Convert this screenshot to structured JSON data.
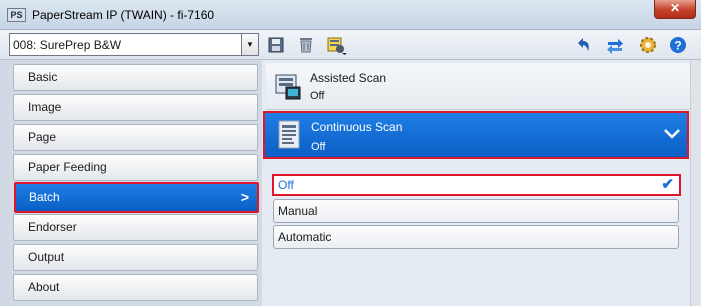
{
  "window": {
    "app_icon_text": "PS",
    "title": "PaperStream IP (TWAIN) - fi-7160",
    "close_glyph": "✕"
  },
  "toolbar": {
    "profile": {
      "value": "008: SurePrep B&W",
      "arrow": "▼"
    },
    "icons": [
      "save-icon",
      "delete-icon",
      "profile-settings-icon",
      "undo-icon",
      "swap-icon",
      "gear-icon",
      "help-icon"
    ]
  },
  "nav": {
    "items": [
      {
        "label": "Basic",
        "selected": false
      },
      {
        "label": "Image",
        "selected": false
      },
      {
        "label": "Page",
        "selected": false
      },
      {
        "label": "Paper Feeding",
        "selected": false
      },
      {
        "label": "Batch",
        "selected": true
      },
      {
        "label": "Endorser",
        "selected": false
      },
      {
        "label": "Output",
        "selected": false
      },
      {
        "label": "About",
        "selected": false
      }
    ],
    "selected_chevron": ">"
  },
  "settings": [
    {
      "name": "Assisted Scan",
      "value": "Off",
      "selected": false
    },
    {
      "name": "Continuous Scan",
      "value": "Off",
      "selected": true
    }
  ],
  "options": [
    {
      "label": "Off",
      "selected": true,
      "check": "✔"
    },
    {
      "label": "Manual",
      "selected": false
    },
    {
      "label": "Automatic",
      "selected": false
    }
  ],
  "colors": {
    "accent_blue": "#0a5fc4",
    "highlight_red": "#e0152a",
    "titlebar": "#dde7f2"
  }
}
